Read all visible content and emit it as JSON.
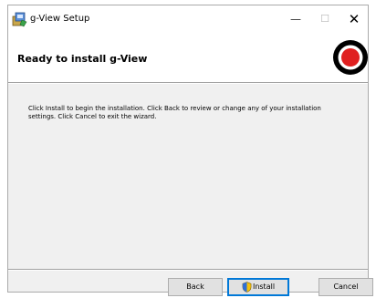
{
  "window": {
    "title": "g-View Setup",
    "controls": {
      "minimize": "—",
      "maximize": "☐",
      "close": "✕"
    }
  },
  "banner": {
    "title": "Ready to install g-View"
  },
  "content": {
    "message": "Click Install to begin the installation. Click Back to review or change any of your installation settings. Click Cancel to exit the wizard."
  },
  "buttons": {
    "back": "Back",
    "install": "Install",
    "cancel": "Cancel"
  },
  "icons": {
    "app": "installer-package-icon",
    "logo": "g-view-logo-icon",
    "uac": "uac-shield-icon"
  },
  "colors": {
    "logo_outer": "#000000",
    "logo_ring": "#ffffff",
    "logo_center": "#e02020",
    "focus": "#0078d7"
  }
}
